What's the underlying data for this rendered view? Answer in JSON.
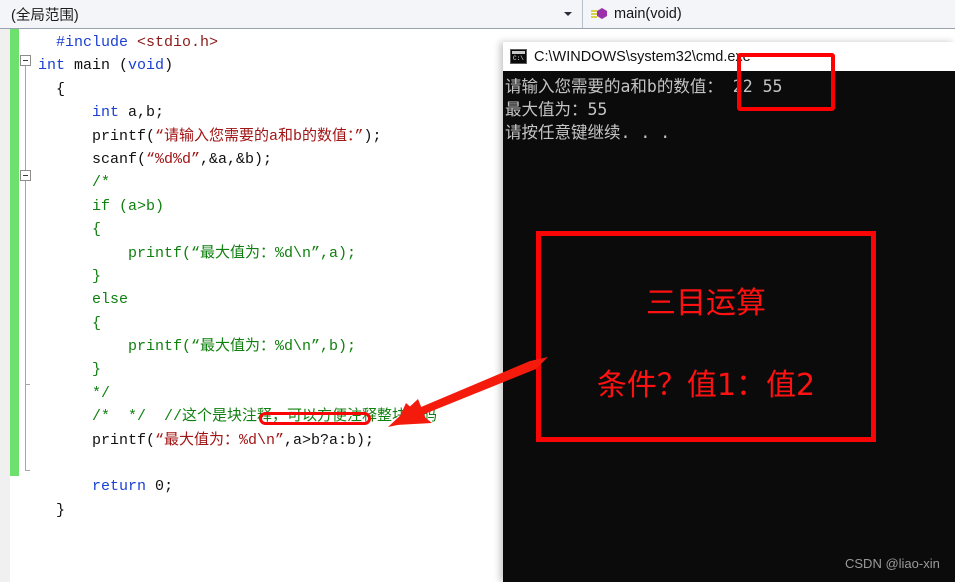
{
  "toolbar": {
    "scope_value": "(全局范围)",
    "member_value": "main(void)",
    "scope_icon": "chevron-down-icon",
    "member_icon": "method-cube-icon"
  },
  "editor": {
    "lines": [
      [
        {
          "t": "  ",
          "c": "plain"
        },
        {
          "t": "#include",
          "c": "pp"
        },
        {
          "t": " ",
          "c": "plain"
        },
        {
          "t": "<stdio.h>",
          "c": "inc"
        }
      ],
      [
        {
          "t": "",
          "c": "plain"
        },
        {
          "t": "int",
          "c": "kw"
        },
        {
          "t": " main ",
          "c": "plain"
        },
        {
          "t": "(",
          "c": "plain"
        },
        {
          "t": "void",
          "c": "kw"
        },
        {
          "t": ")",
          "c": "plain"
        }
      ],
      [
        {
          "t": "  {",
          "c": "plain"
        }
      ],
      [
        {
          "t": "      ",
          "c": "plain"
        },
        {
          "t": "int",
          "c": "kw"
        },
        {
          "t": " a,b;",
          "c": "plain"
        }
      ],
      [
        {
          "t": "      printf(",
          "c": "plain"
        },
        {
          "t": "“请输入您需要的a和b的数值：”",
          "c": "str"
        },
        {
          "t": ");",
          "c": "plain"
        }
      ],
      [
        {
          "t": "      scanf(",
          "c": "plain"
        },
        {
          "t": "“%d%d”",
          "c": "str"
        },
        {
          "t": ",&a,&b);",
          "c": "plain"
        }
      ],
      [
        {
          "t": "      /*",
          "c": "cmt"
        }
      ],
      [
        {
          "t": "      if (a>b)",
          "c": "cmt"
        }
      ],
      [
        {
          "t": "      {",
          "c": "cmt"
        }
      ],
      [
        {
          "t": "          printf(“最大值为：%d\\n”,a);",
          "c": "cmt"
        }
      ],
      [
        {
          "t": "      }",
          "c": "cmt"
        }
      ],
      [
        {
          "t": "      else",
          "c": "cmt"
        }
      ],
      [
        {
          "t": "      {",
          "c": "cmt"
        }
      ],
      [
        {
          "t": "          printf(“最大值为：%d\\n”,b);",
          "c": "cmt"
        }
      ],
      [
        {
          "t": "      }",
          "c": "cmt"
        }
      ],
      [
        {
          "t": "      */",
          "c": "cmt"
        }
      ],
      [
        {
          "t": "      /*  */  //这个是块注释，可以方便注释整块代码",
          "c": "cmt"
        }
      ],
      [
        {
          "t": "      printf(",
          "c": "plain"
        },
        {
          "t": "“最大值为：%d\\n”",
          "c": "str"
        },
        {
          "t": ",a>b?a:b);",
          "c": "plain"
        }
      ],
      [
        {
          "t": "",
          "c": "plain"
        }
      ],
      [
        {
          "t": "      ",
          "c": "plain"
        },
        {
          "t": "return",
          "c": "kw"
        },
        {
          "t": " ",
          "c": "plain"
        },
        {
          "t": "0",
          "c": "plain"
        },
        {
          "t": ";",
          "c": "plain"
        }
      ],
      [
        {
          "t": "  }",
          "c": "plain"
        }
      ]
    ]
  },
  "console": {
    "title": "C:\\WINDOWS\\system32\\cmd.exe",
    "icon": "cmd-icon",
    "lines": [
      "请输入您需要的a和b的数值： 22 55",
      "最大值为：55",
      "请按任意键继续. . ."
    ]
  },
  "annotations": {
    "input_highlight_name": "input-values-highlight",
    "ternary_title": "三目运算",
    "ternary_syntax": "条件？值1：值2",
    "underline_name": "ternary-expression-underline",
    "arrow_name": "pointer-arrow",
    "accent_color": "#ff0000"
  },
  "watermark": {
    "text": "CSDN @liao-xin"
  }
}
